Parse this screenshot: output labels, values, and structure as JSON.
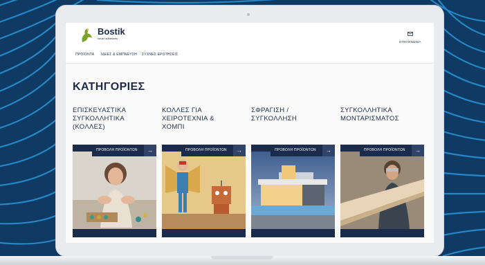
{
  "header": {
    "brand": "Bostik",
    "tagline": "smart adhesives",
    "contact_label": "ΕΠΙΚΟΙΝΩΝΙΑ"
  },
  "nav": {
    "items": [
      "ΠΡΟΪΟΝΤΑ",
      "ΙΔΕΕΣ & ΕΜΠΝΕΥΣΗ",
      "ΣΥΧΝΕΣ ΕΡΩΤΗΣΕΙΣ"
    ]
  },
  "main": {
    "title": "ΚΑΤΗΓΟΡΙΕΣ",
    "categories": [
      {
        "title_lines": [
          "ΕΠΙΣΚΕΥΑΣΤΙΚΑ",
          "ΣΥΓΚΟΛΛΗΤΙΚΑ",
          "(ΚΟΛΛΕΣ)"
        ],
        "button": "ΠΡΟΒΟΛΗ ΠΡΟΪΟΝΤΩΝ",
        "arrow": "→"
      },
      {
        "title_lines": [
          "ΚΟΛΛΕΣ ΓΙΑ",
          "ΧΕΙΡΟΤΕΧΝΙΑ &",
          "ΧΟΜΠΙ"
        ],
        "button": "ΠΡΟΒΟΛΗ ΠΡΟΪΟΝΤΩΝ",
        "arrow": "→"
      },
      {
        "title_lines": [
          "ΣΦΡΑΓΙΣΗ /",
          "ΣΥΓΚΟΛΛΗΣΗ"
        ],
        "button": "ΠΡΟΒΟΛΗ ΠΡΟΪΟΝΤΩΝ",
        "arrow": "→"
      },
      {
        "title_lines": [
          "ΣΥΓΚΟΛΛΗΤΙΚΑ",
          "ΜΟΝΤΑΡΙΣΜΑΤΟΣ"
        ],
        "button": "ΠΡΟΒΟΛΗ ΠΡΟΪΟΝΤΩΝ",
        "arrow": "→"
      }
    ]
  },
  "colors": {
    "brand_navy": "#1a2b4c",
    "background_blue": "#0e3a63",
    "logo_green": "#7aa327"
  }
}
